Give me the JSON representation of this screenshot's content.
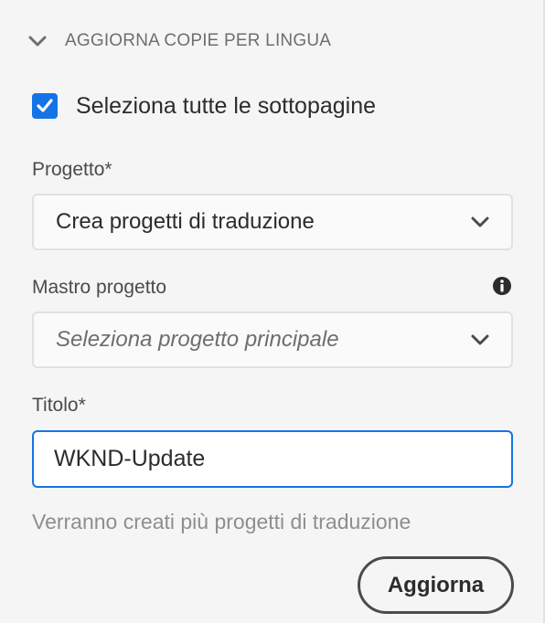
{
  "section": {
    "title": "AGGIORNA COPIE PER LINGUA",
    "expanded": true
  },
  "select_all_subpages": {
    "label": "Seleziona tutte le sottopagine",
    "checked": true
  },
  "project": {
    "label": "Progetto*",
    "value": "Crea progetti di traduzione"
  },
  "master_project": {
    "label": "Mastro progetto",
    "placeholder": "Seleziona progetto principale"
  },
  "title_field": {
    "label": "Titolo*",
    "value": "WKND-Update"
  },
  "help_text": "Verranno creati più progetti di traduzione",
  "update_button": {
    "label": "Aggiorna"
  },
  "icons": {
    "section_toggle": "chevron-down-icon",
    "checkbox": "checkmark-icon",
    "select_dropdown": "chevron-down-icon",
    "info": "info-icon"
  },
  "colors": {
    "accent": "#1473e6",
    "panel_background": "#f5f5f5",
    "help_text": "#8e8e8e"
  }
}
